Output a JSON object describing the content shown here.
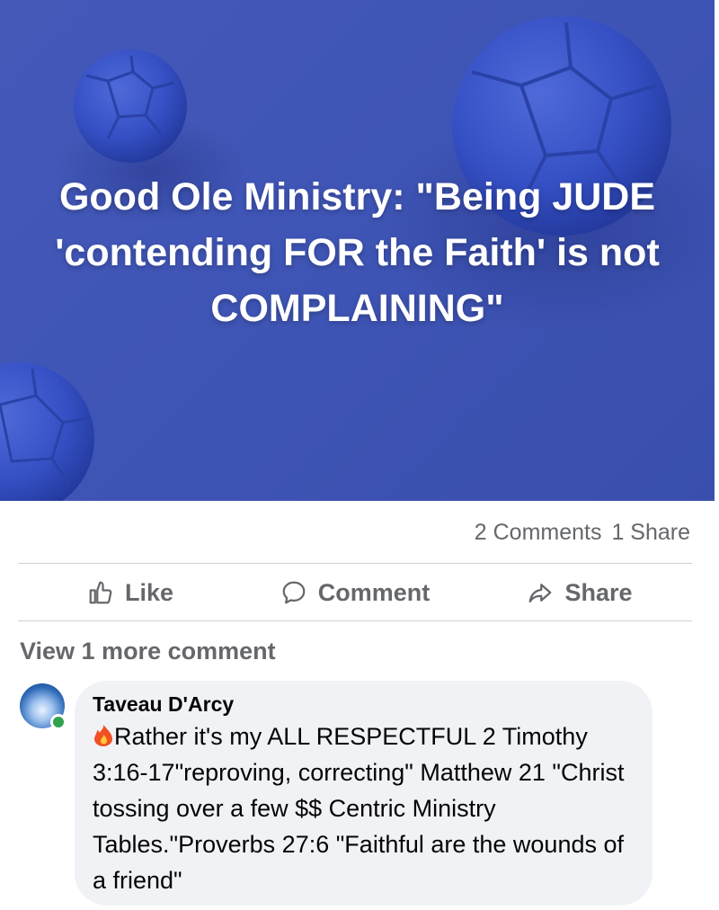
{
  "post": {
    "banner_title": "Good Ole Ministry: \"Being JUDE 'contending FOR the Faith' is not COMPLAINING\"",
    "comments_count": "2 Comments",
    "shares_count": "1 Share"
  },
  "actions": {
    "like": "Like",
    "comment": "Comment",
    "share": "Share"
  },
  "comments": {
    "view_more": "View 1 more comment",
    "items": [
      {
        "author": "Taveau D'Arcy",
        "text": "Rather it's my ALL RESPECTFUL 2 Timothy 3:16-17\"reproving, correcting\" Matthew 21 \"Christ tossing over a few $$ Centric Ministry Tables.\"Proverbs 27:6 \"Faithful are the wounds of a friend\"",
        "online": true
      }
    ]
  },
  "colors": {
    "banner_bg": "#4056b6",
    "muted_text": "#65676b",
    "bubble_bg": "#f0f2f5",
    "online_green": "#31a24c"
  },
  "icons": [
    "thumbs-up-icon",
    "speech-bubble-icon",
    "share-arrow-icon",
    "fire-emoji-icon"
  ]
}
